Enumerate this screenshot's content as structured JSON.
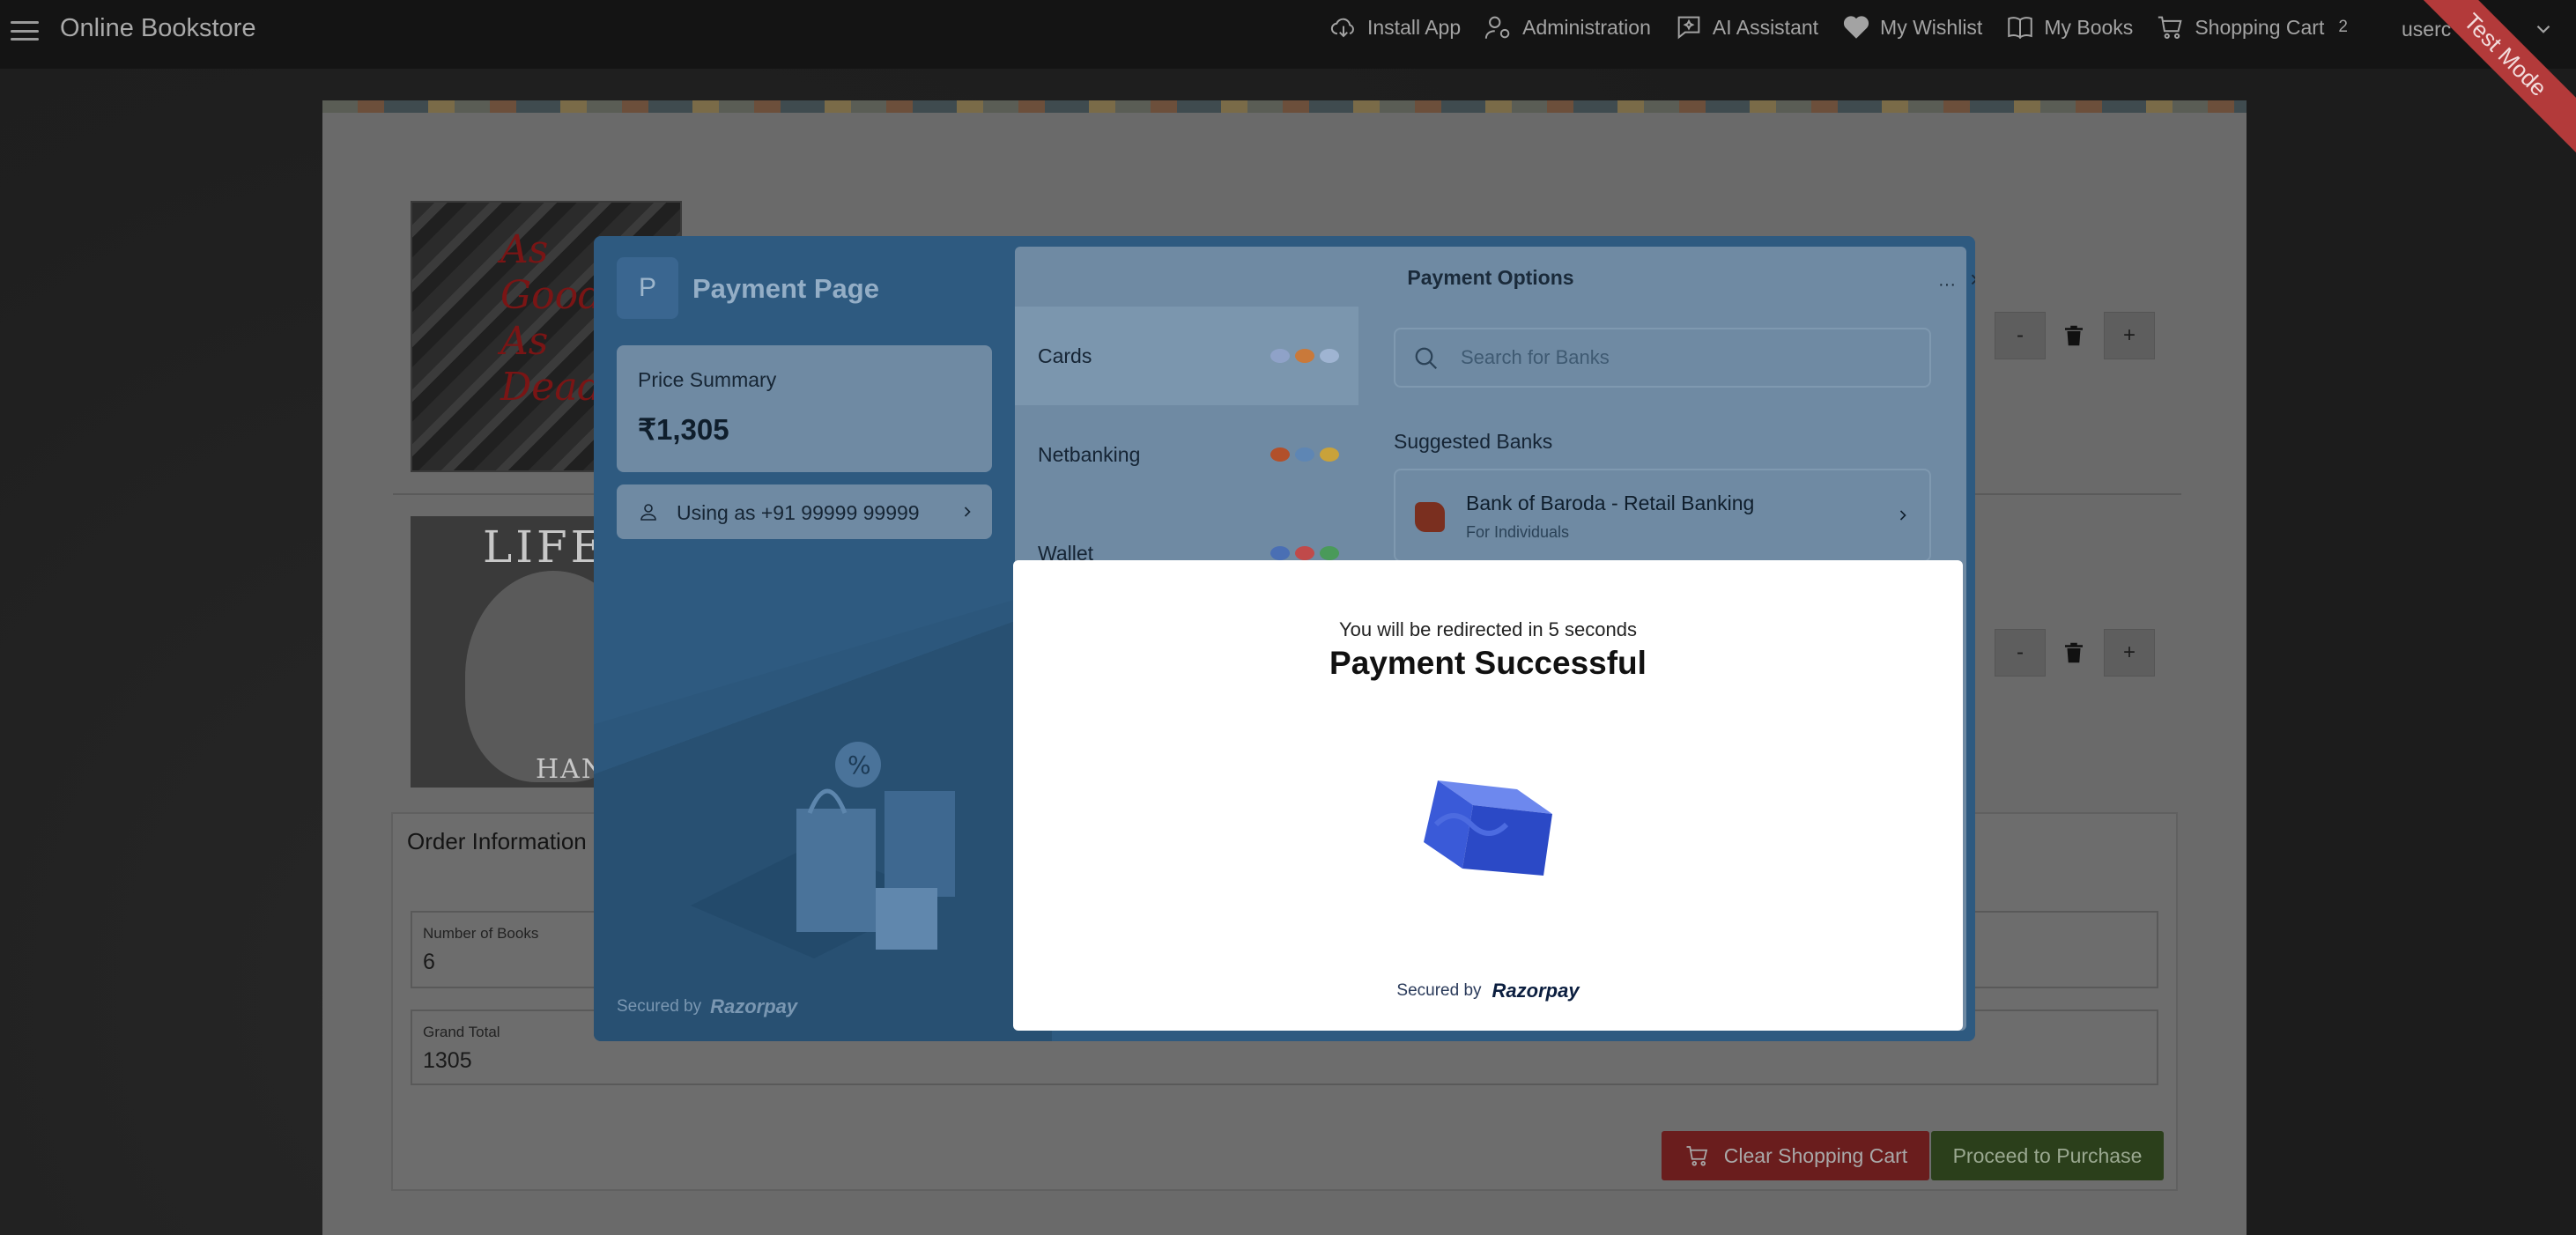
{
  "topbar": {
    "app_title": "Online Bookstore",
    "nav": [
      {
        "label": "Install App",
        "icon": "cloud-download-icon"
      },
      {
        "label": "Administration",
        "icon": "user-gear-icon"
      },
      {
        "label": "AI Assistant",
        "icon": "chat-sparkle-icon"
      },
      {
        "label": "My Wishlist",
        "icon": "heart-icon"
      },
      {
        "label": "My Books",
        "icon": "book-open-icon"
      },
      {
        "label": "Shopping Cart",
        "icon": "cart-icon"
      }
    ],
    "cart_count": "2",
    "user": "userc",
    "test_mode": "Test Mode"
  },
  "cart": {
    "book1": {
      "title_lines": [
        "As",
        "Good",
        "As",
        "Dead"
      ]
    },
    "book2": {
      "title": "LIFE",
      "author": "HANYA"
    },
    "qty_minus": "-",
    "qty_plus": "+"
  },
  "order": {
    "title": "Order Information",
    "num_books_label": "Number of Books",
    "num_books_value": "6",
    "grand_total_label": "Grand Total",
    "grand_total_value": "1305",
    "clear_label": "Clear Shopping Cart",
    "proceed_label": "Proceed to Purchase"
  },
  "razorpay": {
    "logo_letter": "P",
    "page_title": "Payment Page",
    "price_summary_label": "Price Summary",
    "price_value": "₹1,305",
    "using_as": "Using as +91 99999 99999",
    "secured_by": "Secured by",
    "brand": "Razorpay",
    "options_title": "Payment Options",
    "more": "···",
    "close": "×",
    "tabs": [
      {
        "label": "Cards"
      },
      {
        "label": "Netbanking"
      },
      {
        "label": "Wallet"
      }
    ],
    "search_placeholder": "Search for Banks",
    "suggested_label": "Suggested Banks",
    "bank": {
      "name": "Bank of Baroda - Retail Banking",
      "sub": "For Individuals"
    }
  },
  "success": {
    "redirect": "You will be redirected in 5 seconds",
    "title": "Payment Successful",
    "secured_by": "Secured by",
    "brand": "Razorpay"
  },
  "colors": {
    "success_cube": "#3b5bd9",
    "clear_button": "#6a1d1d",
    "proceed_button": "#2b3f1b"
  }
}
